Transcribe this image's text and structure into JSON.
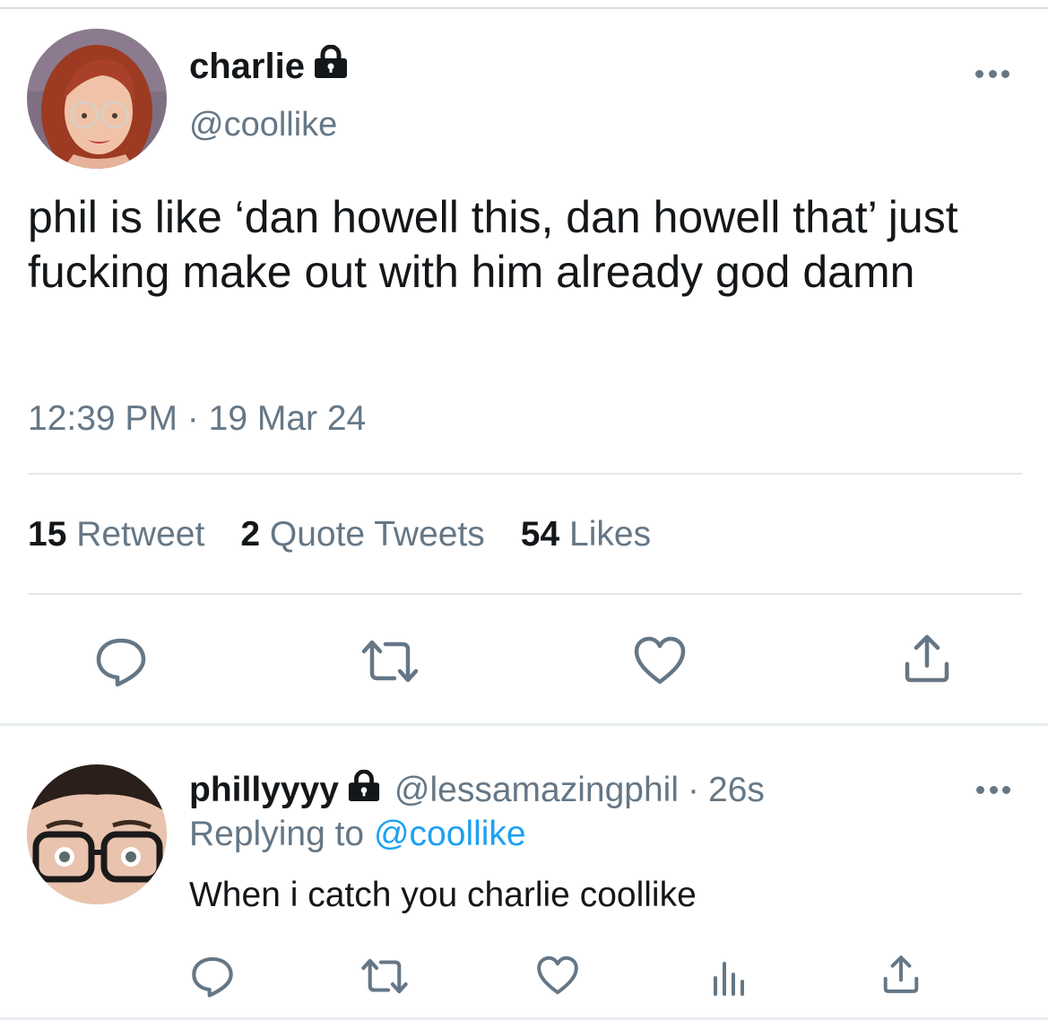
{
  "tweet": {
    "author": {
      "display_name": "charlie",
      "handle": "@coollike",
      "protected": true
    },
    "text": "phil is like ‘dan howell this, dan howell that’ just fucking make out with him already god damn",
    "time": "12:39 PM",
    "separator": "·",
    "date": "19 Mar 24",
    "stats": {
      "retweets_count": "15",
      "retweets_label": "Retweet",
      "quotes_count": "2",
      "quotes_label": "Quote Tweets",
      "likes_count": "54",
      "likes_label": "Likes"
    },
    "actions": [
      "reply-icon",
      "retweet-icon",
      "like-icon",
      "share-icon"
    ]
  },
  "reply": {
    "author": {
      "display_name": "phillyyyy",
      "handle": "@lessamazingphil",
      "protected": true
    },
    "separator": "·",
    "age": "26s",
    "replying_prefix": "Replying to",
    "replying_to": "@coollike",
    "text": "When i catch you charlie coollike",
    "actions": [
      "reply-icon",
      "retweet-icon",
      "like-icon",
      "analytics-icon",
      "share-icon"
    ]
  },
  "colors": {
    "text": "#14171a",
    "secondary": "#657786",
    "link": "#1da1f2",
    "divider": "#e1e8ed"
  }
}
